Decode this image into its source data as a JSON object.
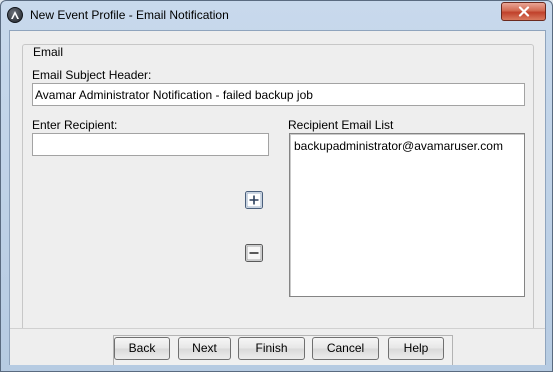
{
  "window": {
    "title": "New Event Profile - Email Notification",
    "close_symbol": "✕"
  },
  "email_group": {
    "legend": "Email",
    "subject_label": "Email Subject Header:",
    "subject_value": "Avamar Administrator Notification - failed backup job",
    "recipient_label": "Enter Recipient:",
    "recipient_value": "",
    "list_label": "Recipient Email List",
    "recipients": [
      "backupadministrator@avamaruser.com"
    ]
  },
  "buttons": {
    "back": "Back",
    "next": "Next",
    "finish": "Finish",
    "cancel": "Cancel",
    "help": "Help"
  },
  "icons": {
    "app": "avamar-logo-icon",
    "add": "plus-icon",
    "remove": "minus-icon",
    "close": "close-icon"
  },
  "colors": {
    "titlebar": "#c8d9ec",
    "close_button": "#c0412b",
    "dialog_background": "#eeeeee"
  }
}
